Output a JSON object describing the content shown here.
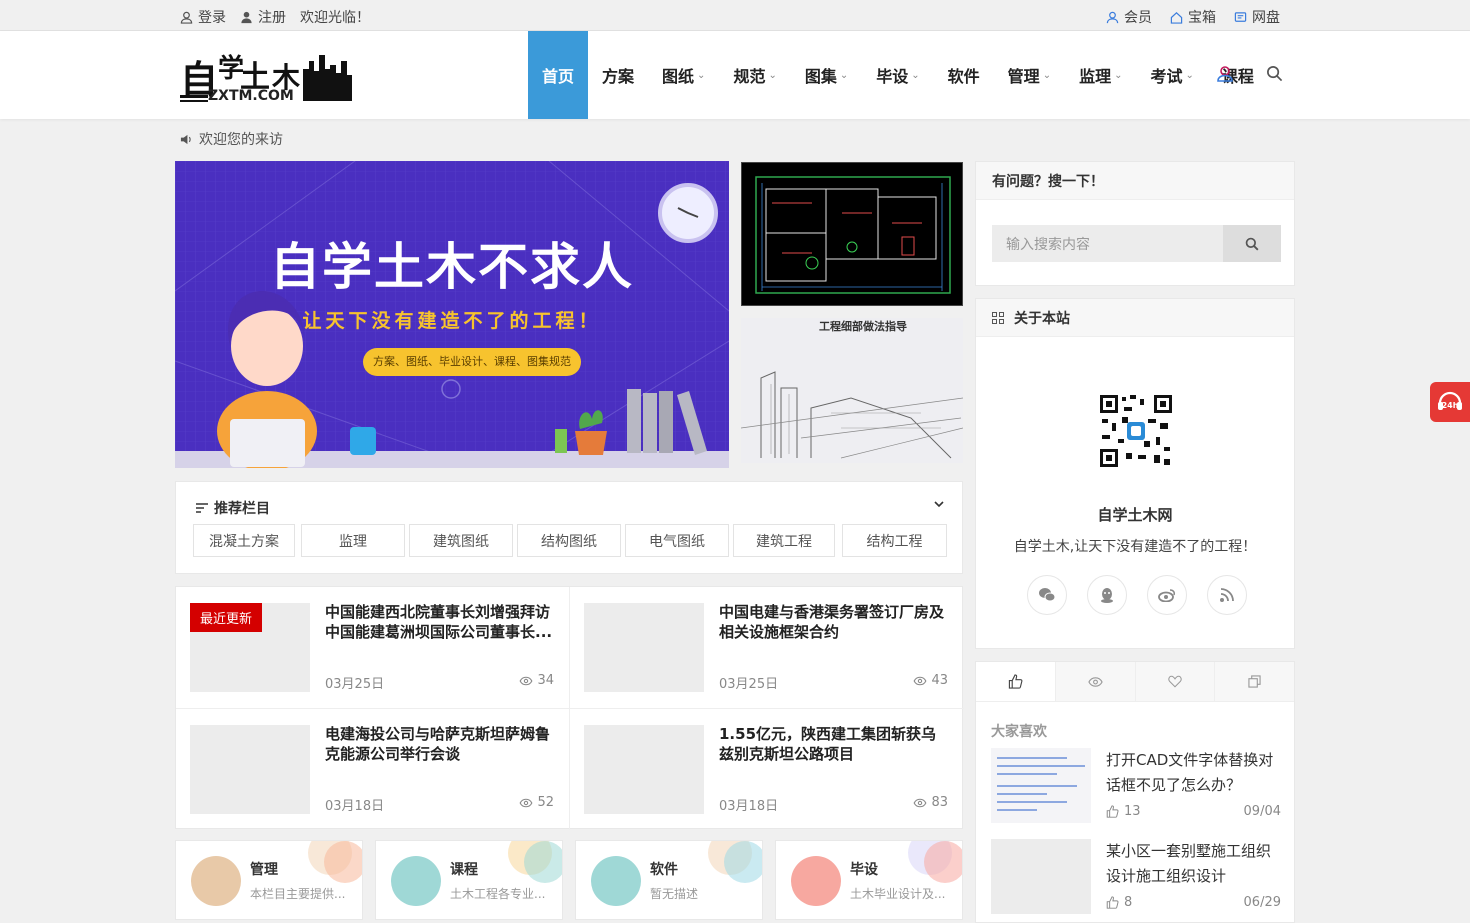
{
  "topbar": {
    "login": "登录",
    "register": "注册",
    "welcome": "欢迎光临！",
    "member": "会员",
    "treasure": "宝箱",
    "disk": "网盘"
  },
  "logo": {
    "text": "自学土木",
    "sub": "ZXTM.COM"
  },
  "nav": {
    "items": [
      {
        "label": "首页",
        "active": true,
        "dropdown": false
      },
      {
        "label": "方案",
        "active": false,
        "dropdown": false
      },
      {
        "label": "图纸",
        "active": false,
        "dropdown": true
      },
      {
        "label": "规范",
        "active": false,
        "dropdown": true
      },
      {
        "label": "图集",
        "active": false,
        "dropdown": true
      },
      {
        "label": "毕设",
        "active": false,
        "dropdown": true
      },
      {
        "label": "软件",
        "active": false,
        "dropdown": false
      },
      {
        "label": "管理",
        "active": false,
        "dropdown": true
      },
      {
        "label": "监理",
        "active": false,
        "dropdown": true
      },
      {
        "label": "考试",
        "active": false,
        "dropdown": true
      },
      {
        "label": "课程",
        "active": false,
        "dropdown": false
      }
    ],
    "caret": "⌄"
  },
  "notice": "欢迎您的来访",
  "banner": {
    "title": "自学土木不求人",
    "subtitle": "让天下没有建造不了的工程！",
    "pill": "方案、图纸、毕业设计、课程、图集规范"
  },
  "side_images": {
    "drawing_caption": "工程细部做法指导"
  },
  "recommend": {
    "title": "推荐栏目",
    "tags": [
      "混凝土方案",
      "监理",
      "建筑图纸",
      "结构图纸",
      "电气图纸",
      "建筑工程",
      "结构工程"
    ]
  },
  "posts": [
    {
      "title": "中国能建西北院董事长刘增强拜访中国能建葛洲坝国际公司董事长...",
      "date": "03月25日",
      "views": "34",
      "badge": "最近更新"
    },
    {
      "title": "中国电建与香港渠务署签订厂房及相关设施框架合约",
      "date": "03月25日",
      "views": "43",
      "badge": ""
    },
    {
      "title": "电建海投公司与哈萨克斯坦萨姆鲁克能源公司举行会谈",
      "date": "03月18日",
      "views": "52",
      "badge": ""
    },
    {
      "title": "1.55亿元，陕西建工集团斩获乌兹别克斯坦公路项目",
      "date": "03月18日",
      "views": "83",
      "badge": ""
    }
  ],
  "categories": [
    {
      "name": "管理",
      "desc": "本栏目主要提供...",
      "color": "#e8c9a8"
    },
    {
      "name": "课程",
      "desc": "土木工程各专业...",
      "color": "#9fd8d6"
    },
    {
      "name": "软件",
      "desc": "暂无描述",
      "color": "#9fd8d6"
    },
    {
      "name": "毕设",
      "desc": "土木毕业设计及...",
      "color": "#f7a8a0"
    }
  ],
  "search_widget": {
    "title": "有问题？搜一下！",
    "placeholder": "输入搜索内容"
  },
  "about": {
    "title": "关于本站",
    "site_name": "自学土木网",
    "description": "自学土木,让天下没有建造不了的工程！"
  },
  "popular": {
    "heading": "大家喜欢",
    "items": [
      {
        "title": "打开CAD文件字体替换对话框不见了怎么办？",
        "likes": "13",
        "date": "09/04"
      },
      {
        "title": "某小区一套别墅施工组织设计施工组织设计",
        "likes": "8",
        "date": "06/29"
      }
    ]
  },
  "float_badge": "24h",
  "colors": {
    "accent": "#3b9ad9",
    "badge": "#d40000",
    "banner": "#4a2fc0"
  }
}
